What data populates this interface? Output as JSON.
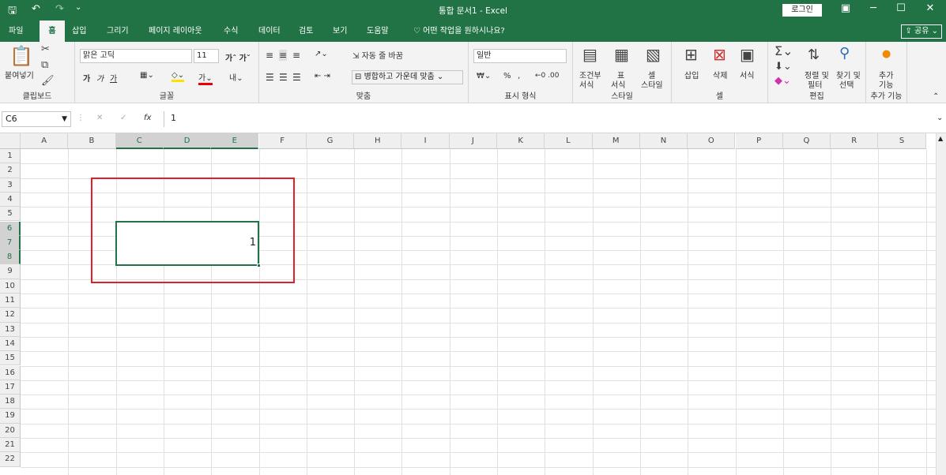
{
  "title_bar": {
    "title": "통합 문서1  -  Excel",
    "login": "로그인",
    "save_icon": "save-icon",
    "undo_icon": "undo-icon",
    "redo_icon": "redo-icon",
    "qa_more": "⌄",
    "ribbon_display": "ribbon-display-icon",
    "minimize": "minimize-icon",
    "maximize": "maximize-icon",
    "close": "close-icon"
  },
  "tabs": [
    "파일",
    "홈",
    "삽입",
    "그리기",
    "페이지 레이아웃",
    "수식",
    "데이터",
    "검토",
    "보기",
    "도움말"
  ],
  "tell_me": "어떤 작업을 원하시나요?",
  "share": "공유",
  "ribbon": {
    "clipboard": {
      "paste": "붙여넣기",
      "label": "클립보드"
    },
    "font": {
      "name": "맑은 고딕",
      "size": "11",
      "label": "글꼴"
    },
    "align": {
      "wrap": "자동 줄 바꿈",
      "merge": "병합하고 가운데 맞춤",
      "label": "맞춤"
    },
    "number": {
      "format": "일반",
      "label": "표시 형식"
    },
    "styles": {
      "cond1": "조건부",
      "cond2": "서식",
      "table1": "표",
      "table2": "서식",
      "cell1": "셀",
      "cell2": "스타일",
      "label": "스타일"
    },
    "cells": {
      "insert": "삽입",
      "delete": "삭제",
      "format": "서식",
      "label": "셀"
    },
    "editing": {
      "sort1": "정렬 및",
      "sort2": "필터",
      "find1": "찾기 및",
      "find2": "선택",
      "label": "편집"
    },
    "addins": {
      "a1": "추가",
      "a2": "기능",
      "label": "추가 기능"
    }
  },
  "formula_bar": {
    "name_box": "C6",
    "fx": "fx",
    "value": "1"
  },
  "columns": [
    "A",
    "B",
    "C",
    "D",
    "E",
    "F",
    "G",
    "H",
    "I",
    "J",
    "K",
    "L",
    "M",
    "N",
    "O",
    "P",
    "Q",
    "R",
    "S"
  ],
  "rows": [
    "1",
    "2",
    "3",
    "4",
    "5",
    "6",
    "7",
    "8",
    "9",
    "10",
    "11",
    "12",
    "13",
    "14",
    "15",
    "16",
    "17",
    "18",
    "19",
    "20",
    "21",
    "22"
  ],
  "selected_cells": {
    "range": "C6:E8",
    "value": "1"
  }
}
